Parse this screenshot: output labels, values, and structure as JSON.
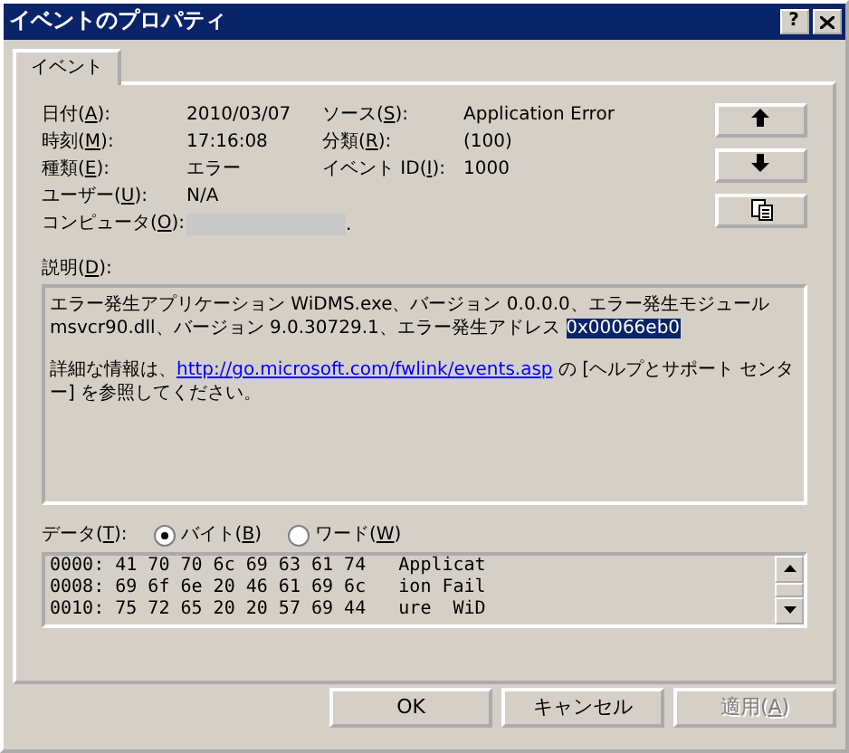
{
  "window": {
    "title": "イベントのプロパティ",
    "help_button": "?"
  },
  "tabs": [
    {
      "label": "イベント",
      "selected": true
    }
  ],
  "fields": [
    {
      "label": {
        "pre": "日付(",
        "key": "A",
        "post": "):"
      },
      "value": "2010/03/07",
      "label_2": {
        "pre": "ソース(",
        "key": "S",
        "post": "):"
      },
      "value_2": "Application Error"
    },
    {
      "label": {
        "pre": "時刻(",
        "key": "M",
        "post": "):"
      },
      "value": "17:16:08",
      "label_2": {
        "pre": "分類(",
        "key": "R",
        "post": "):"
      },
      "value_2": "(100)"
    },
    {
      "label": {
        "pre": "種類(",
        "key": "E",
        "post": "):"
      },
      "value": "エラー",
      "label_2": {
        "pre": "イベント ID(",
        "key": "I",
        "post": "):"
      },
      "value_2": "1000"
    },
    {
      "label": {
        "pre": "ユーザー(",
        "key": "U",
        "post": "):"
      },
      "value": "N/A"
    },
    {
      "label": {
        "pre": "コンピュータ(",
        "key": "O",
        "post": "):"
      },
      "value": ".",
      "redacted": true
    }
  ],
  "description": {
    "label": {
      "pre": "説明(",
      "key": "D",
      "post": "):"
    },
    "paragraphs": [
      [
        {
          "kind": "text",
          "text": "エラー発生アプリケーション WiDMS.exe、バージョン 0.0.0.0、エラー発生モジュール msvcr90.dll、バージョン 9.0.30729.1、エラー発生アドレス "
        },
        {
          "kind": "selection",
          "text": "0x00066eb0"
        }
      ],
      [
        {
          "kind": "text",
          "text": "詳細な情報は、"
        },
        {
          "kind": "link",
          "text": "http://go.microsoft.com/fwlink/events.asp"
        },
        {
          "kind": "text",
          "text": " の [ヘルプとサポート センター] を参照してください。"
        }
      ]
    ]
  },
  "data": {
    "label": {
      "pre": "データ(",
      "key": "T",
      "post": "):"
    },
    "formats": [
      {
        "label": {
          "pre": "バイト(",
          "key": "B",
          "post": ")"
        },
        "selected": true
      },
      {
        "label": {
          "pre": "ワード(",
          "key": "W",
          "post": ")"
        },
        "selected": false
      }
    ],
    "lines": [
      "0000: 41 70 70 6c 69 63 61 74   Applicat",
      "0008: 69 6f 6e 20 46 61 69 6c   ion Fail",
      "0010: 75 72 65 20 20 57 69 44   ure  WiD"
    ]
  },
  "buttons": [
    {
      "label": {
        "pre": "OK"
      },
      "disabled": false
    },
    {
      "label": {
        "pre": "キャンセル"
      },
      "disabled": false
    },
    {
      "label": {
        "pre": "適用(",
        "key": "A",
        "post": ")"
      },
      "disabled": true
    }
  ]
}
